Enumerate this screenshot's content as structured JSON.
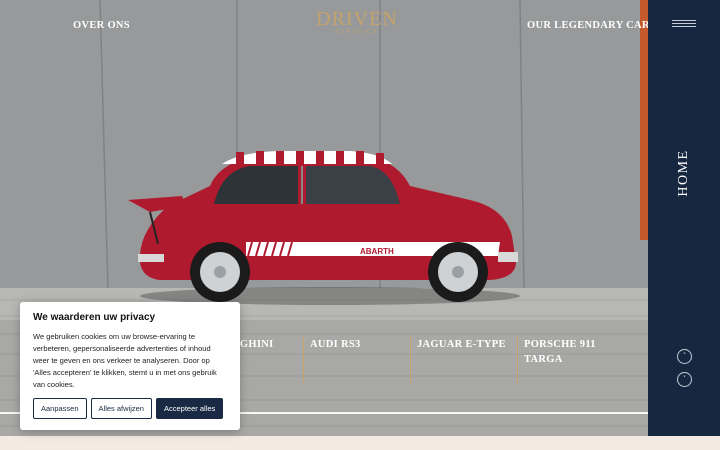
{
  "header": {
    "nav_left": "OVER ONS",
    "nav_right": "OUR LEGENDARY CARS",
    "logo_main": "DRIVEN",
    "logo_sub": "CLASSICS"
  },
  "sidebar": {
    "page_label": "HOME",
    "menu_icon": "hamburger-icon",
    "scroll_up_icon": "chevron-up-icon",
    "scroll_down_icon": "chevron-down-icon",
    "scroll_up_glyph": "˄",
    "scroll_down_glyph": "˅"
  },
  "car_list": [
    {
      "label": "RGHINI"
    },
    {
      "label": "AUDI RS3"
    },
    {
      "label": "JAGUAR E-TYPE"
    },
    {
      "label": "PORSCHE 911 TARGA"
    }
  ],
  "hero": {
    "car_badge": "ABARTH"
  },
  "cookie_banner": {
    "title": "We waarderen uw privacy",
    "text": "We gebruiken cookies om uw browse-ervaring te verbeteren, gepersonaliseerde advertenties of inhoud weer te geven en ons verkeer te analyseren. Door op 'Alles accepteren' te klikken, stemt u in met ons gebruik van cookies.",
    "btn_customize": "Aanpassen",
    "btn_reject": "Alles afwijzen",
    "btn_accept": "Accepteer alles"
  },
  "colors": {
    "navy": "#172740",
    "gold": "#c9a566",
    "cream": "#f3ebe1",
    "car_red": "#b01a2e"
  }
}
